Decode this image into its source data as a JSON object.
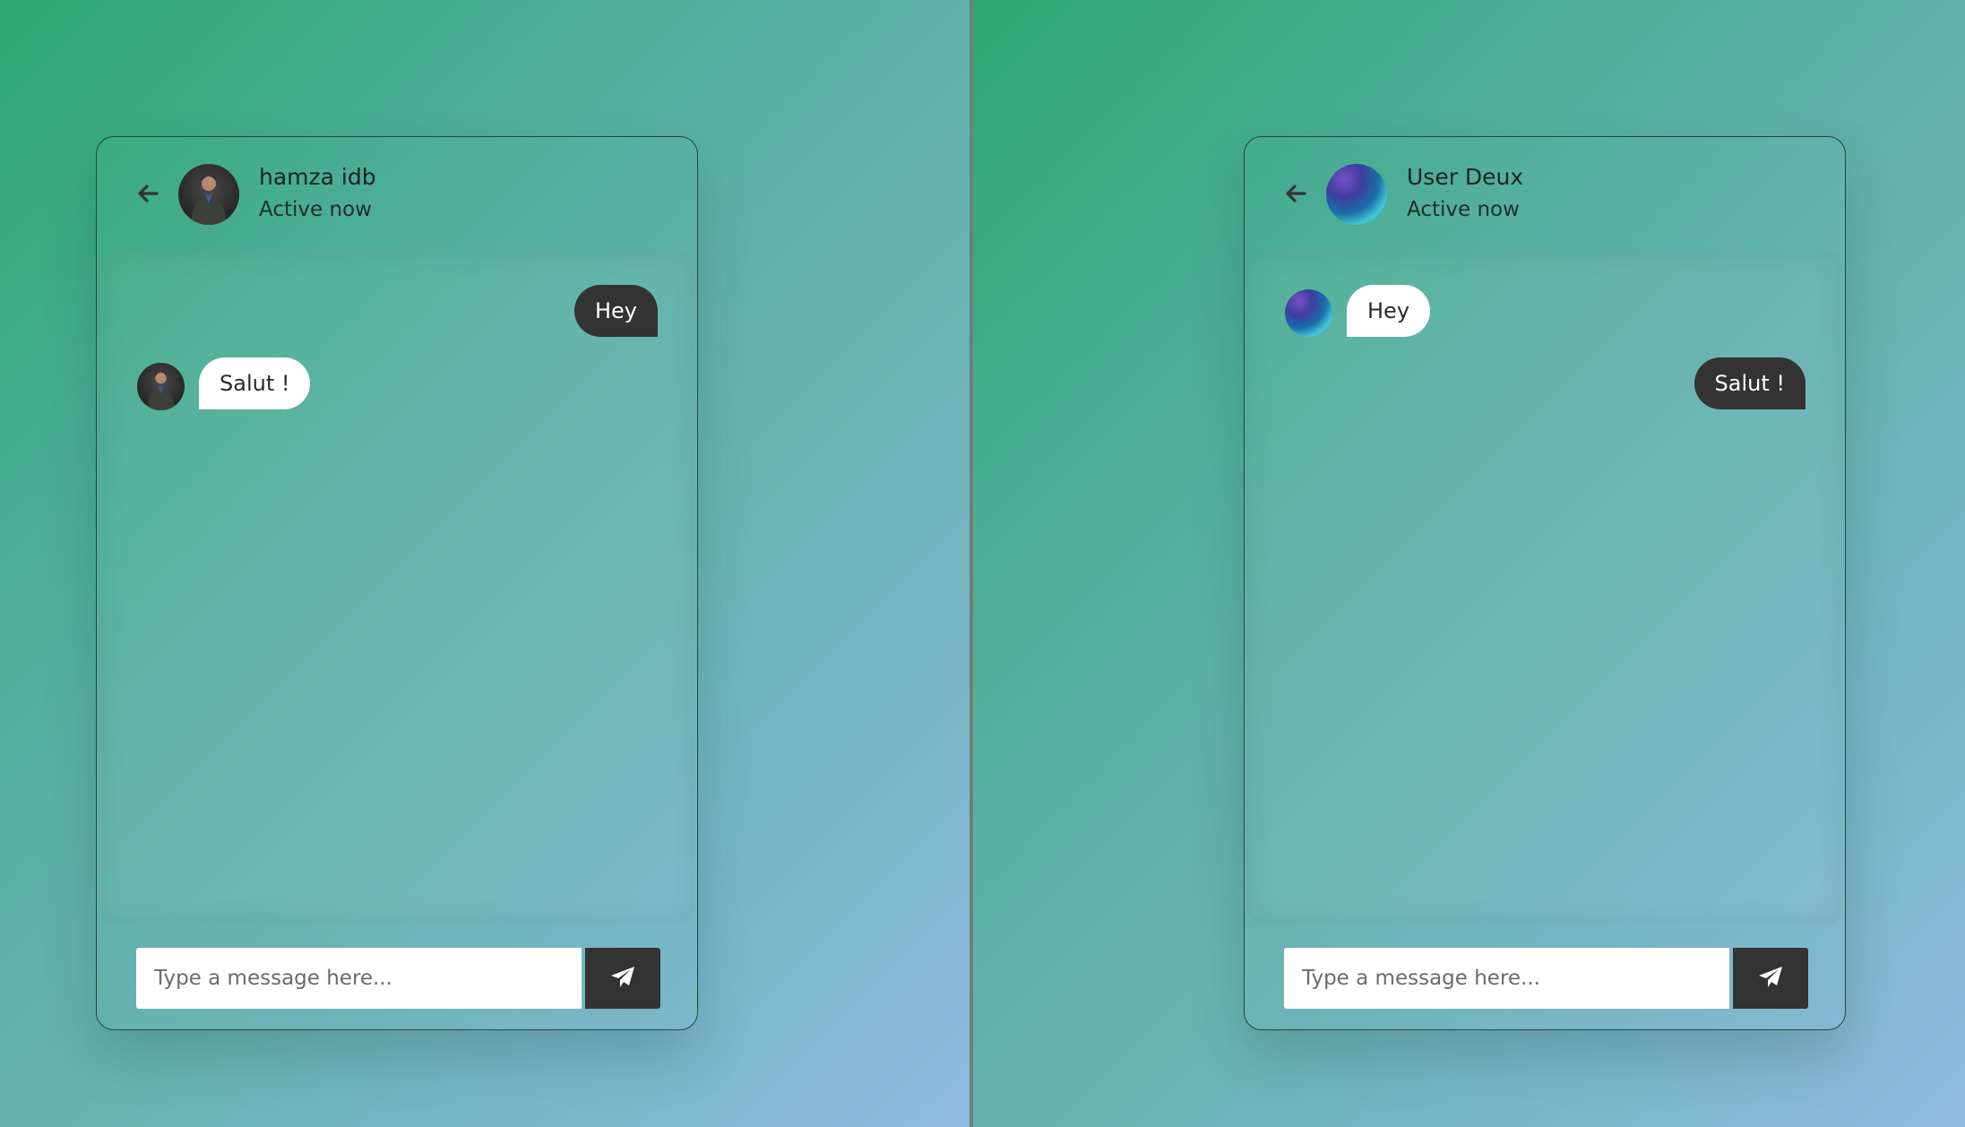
{
  "colors": {
    "bubble_out_bg": "#333333",
    "bubble_in_bg": "#ffffff",
    "send_button_bg": "#333333",
    "background_start": "#2ea873",
    "background_end": "#8fbade"
  },
  "icons": {
    "back": "arrow-left-icon",
    "send": "paper-plane-icon"
  },
  "left_window": {
    "header": {
      "name": "hamza idb",
      "status": "Active now",
      "avatar": "person-avatar"
    },
    "messages": [
      {
        "direction": "outgoing",
        "text": "Hey"
      },
      {
        "direction": "incoming",
        "text": "Salut !"
      }
    ],
    "composer": {
      "placeholder": "Type a message here..."
    }
  },
  "right_window": {
    "header": {
      "name": "User Deux",
      "status": "Active now",
      "avatar": "aurora-avatar"
    },
    "messages": [
      {
        "direction": "incoming",
        "text": "Hey"
      },
      {
        "direction": "outgoing",
        "text": "Salut !"
      }
    ],
    "composer": {
      "placeholder": "Type a message here..."
    }
  }
}
